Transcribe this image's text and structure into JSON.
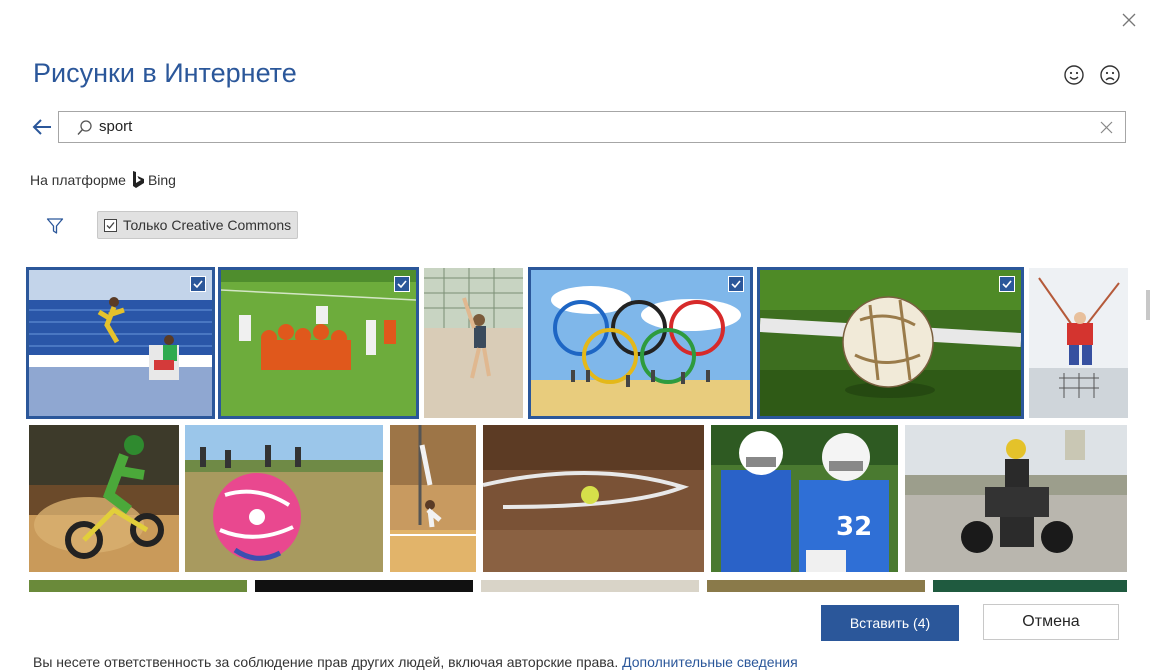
{
  "dialog": {
    "title": "Рисунки в Интернете",
    "close_icon": "close-icon",
    "feedback": {
      "happy_icon": "smile-icon",
      "sad_icon": "frown-icon"
    }
  },
  "search": {
    "back_icon": "arrow-left-icon",
    "search_icon": "search-icon",
    "query": "sport",
    "clear_icon": "clear-icon"
  },
  "provider": {
    "label": "На платформе",
    "brand": "Bing",
    "brand_icon": "bing-logo-icon"
  },
  "filter": {
    "filter_icon": "filter-icon",
    "creative_commons_label": "Только Creative Commons",
    "creative_commons_checked": true
  },
  "images": {
    "row1": [
      {
        "subject": "high jump athlete in stadium",
        "selected": true
      },
      {
        "subject": "football team on field",
        "selected": true
      },
      {
        "subject": "tennis player on clay court",
        "selected": false
      },
      {
        "subject": "olympic rings with gymnasts",
        "selected": true
      },
      {
        "subject": "soccer ball on grass",
        "selected": true
      },
      {
        "subject": "climber on rope net",
        "selected": false
      }
    ],
    "row2": [
      {
        "subject": "motocross rider",
        "selected": false
      },
      {
        "subject": "pink soccer ball on field",
        "selected": false
      },
      {
        "subject": "gymnast on pole",
        "selected": false
      },
      {
        "subject": "ball on dirt track",
        "selected": false
      },
      {
        "subject": "american football players",
        "selected": false
      },
      {
        "subject": "quad bike rider",
        "selected": false
      }
    ]
  },
  "footer": {
    "insert_label": "Вставить (4)",
    "cancel_label": "Отмена",
    "disclaimer_text": "Вы несете ответственность за соблюдение прав других людей, включая авторские права.",
    "learn_more_link": "Дополнительные сведения"
  },
  "colors": {
    "accent": "#2b579a",
    "title": "#2b579a"
  }
}
